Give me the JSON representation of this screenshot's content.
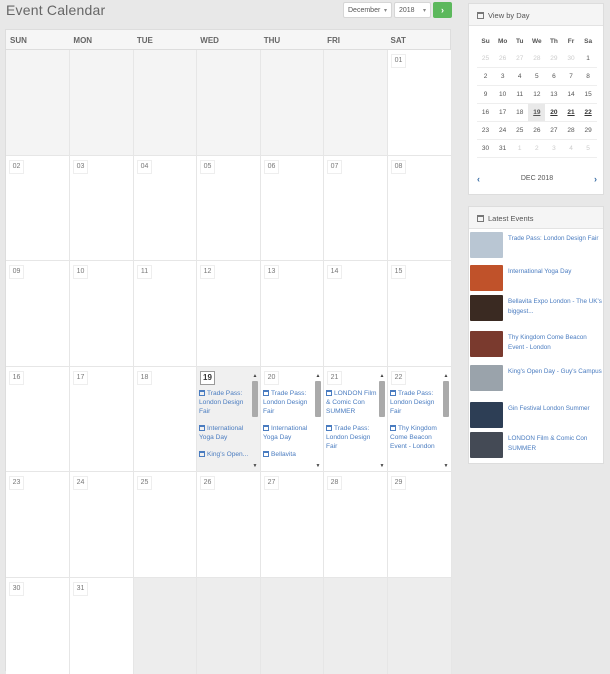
{
  "header": {
    "title": "Event Calendar",
    "month_select": "December",
    "year_select": "2018",
    "next_icon": "chevron-right-icon"
  },
  "calendar": {
    "weekdays": [
      "SUN",
      "MON",
      "TUE",
      "WED",
      "THU",
      "FRI",
      "SAT"
    ],
    "today": "19",
    "days": [
      "01",
      "02",
      "03",
      "04",
      "05",
      "06",
      "07",
      "08",
      "09",
      "10",
      "11",
      "12",
      "13",
      "14",
      "15",
      "16",
      "17",
      "18",
      "19",
      "20",
      "21",
      "22",
      "23",
      "24",
      "25",
      "26",
      "27",
      "28",
      "29",
      "30",
      "31"
    ],
    "events": {
      "19": [
        "Trade Pass: London Design Fair",
        "International Yoga Day",
        "King's Open..."
      ],
      "20": [
        "Trade Pass: London Design Fair",
        "International Yoga Day",
        "Bellavita"
      ],
      "21": [
        "LONDON Film & Comic Con SUMMER",
        "Trade Pass: London Design Fair"
      ],
      "22": [
        "Trade Pass: London Design Fair",
        "Thy Kingdom Come Beacon Event - London"
      ]
    }
  },
  "view_by_day": {
    "title": "View by Day",
    "weekdays": [
      "Su",
      "Mo",
      "Tu",
      "We",
      "Th",
      "Fr",
      "Sa"
    ],
    "weeks": [
      [
        "25",
        "26",
        "27",
        "28",
        "29",
        "30",
        "1"
      ],
      [
        "2",
        "3",
        "4",
        "5",
        "6",
        "7",
        "8"
      ],
      [
        "9",
        "10",
        "11",
        "12",
        "13",
        "14",
        "15"
      ],
      [
        "16",
        "17",
        "18",
        "19",
        "20",
        "21",
        "22"
      ],
      [
        "23",
        "24",
        "25",
        "26",
        "27",
        "28",
        "29"
      ],
      [
        "30",
        "31",
        "1",
        "2",
        "3",
        "4",
        "5"
      ]
    ],
    "month_label": "DEC 2018"
  },
  "latest_events": {
    "title": "Latest Events",
    "items": [
      {
        "text": "Trade Pass: London Design Fair",
        "color": "#b9c6d3"
      },
      {
        "text": "International Yoga Day",
        "color": "#c0522a"
      },
      {
        "text": "Bellavita Expo London - The UK's biggest...",
        "color": "#3a2a22"
      },
      {
        "text": "Thy Kingdom Come Beacon Event - London",
        "color": "#7a3a2e"
      },
      {
        "text": "King's Open Day - Guy's Campus",
        "color": "#9aa3ab"
      },
      {
        "text": "Gin Festival London Summer",
        "color": "#2d3e55"
      },
      {
        "text": "LONDON Film & Comic Con SUMMER",
        "color": "#444a55"
      }
    ]
  }
}
